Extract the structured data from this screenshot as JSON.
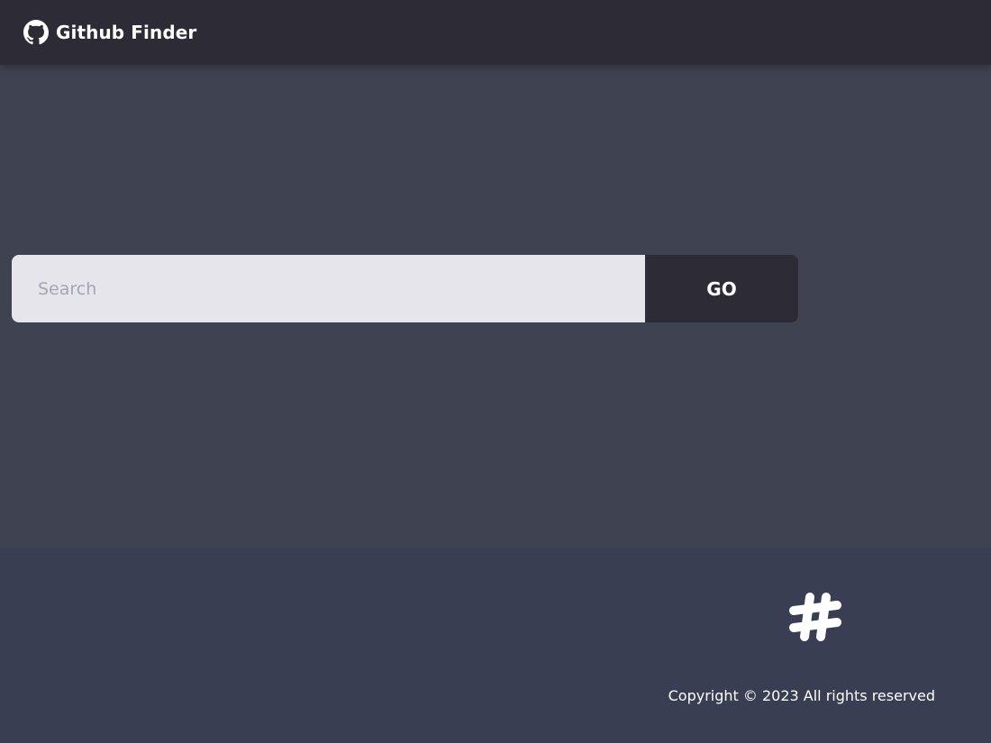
{
  "navbar": {
    "title": "Github Finder",
    "logo_icon": "github-icon"
  },
  "search": {
    "placeholder": "Search",
    "value": "",
    "button_label": "GO"
  },
  "footer": {
    "logo_icon": "hashtag-icon",
    "copyright": "Copyright © 2023 All rights reserved"
  },
  "colors": {
    "navbar_bg": "#2c2b36",
    "main_bg": "#3f4250",
    "footer_bg": "#393e52",
    "input_bg": "#e6e5ec",
    "button_bg": "#2c2b36",
    "text_light": "#ffffff",
    "placeholder": "#a3a6b3"
  }
}
